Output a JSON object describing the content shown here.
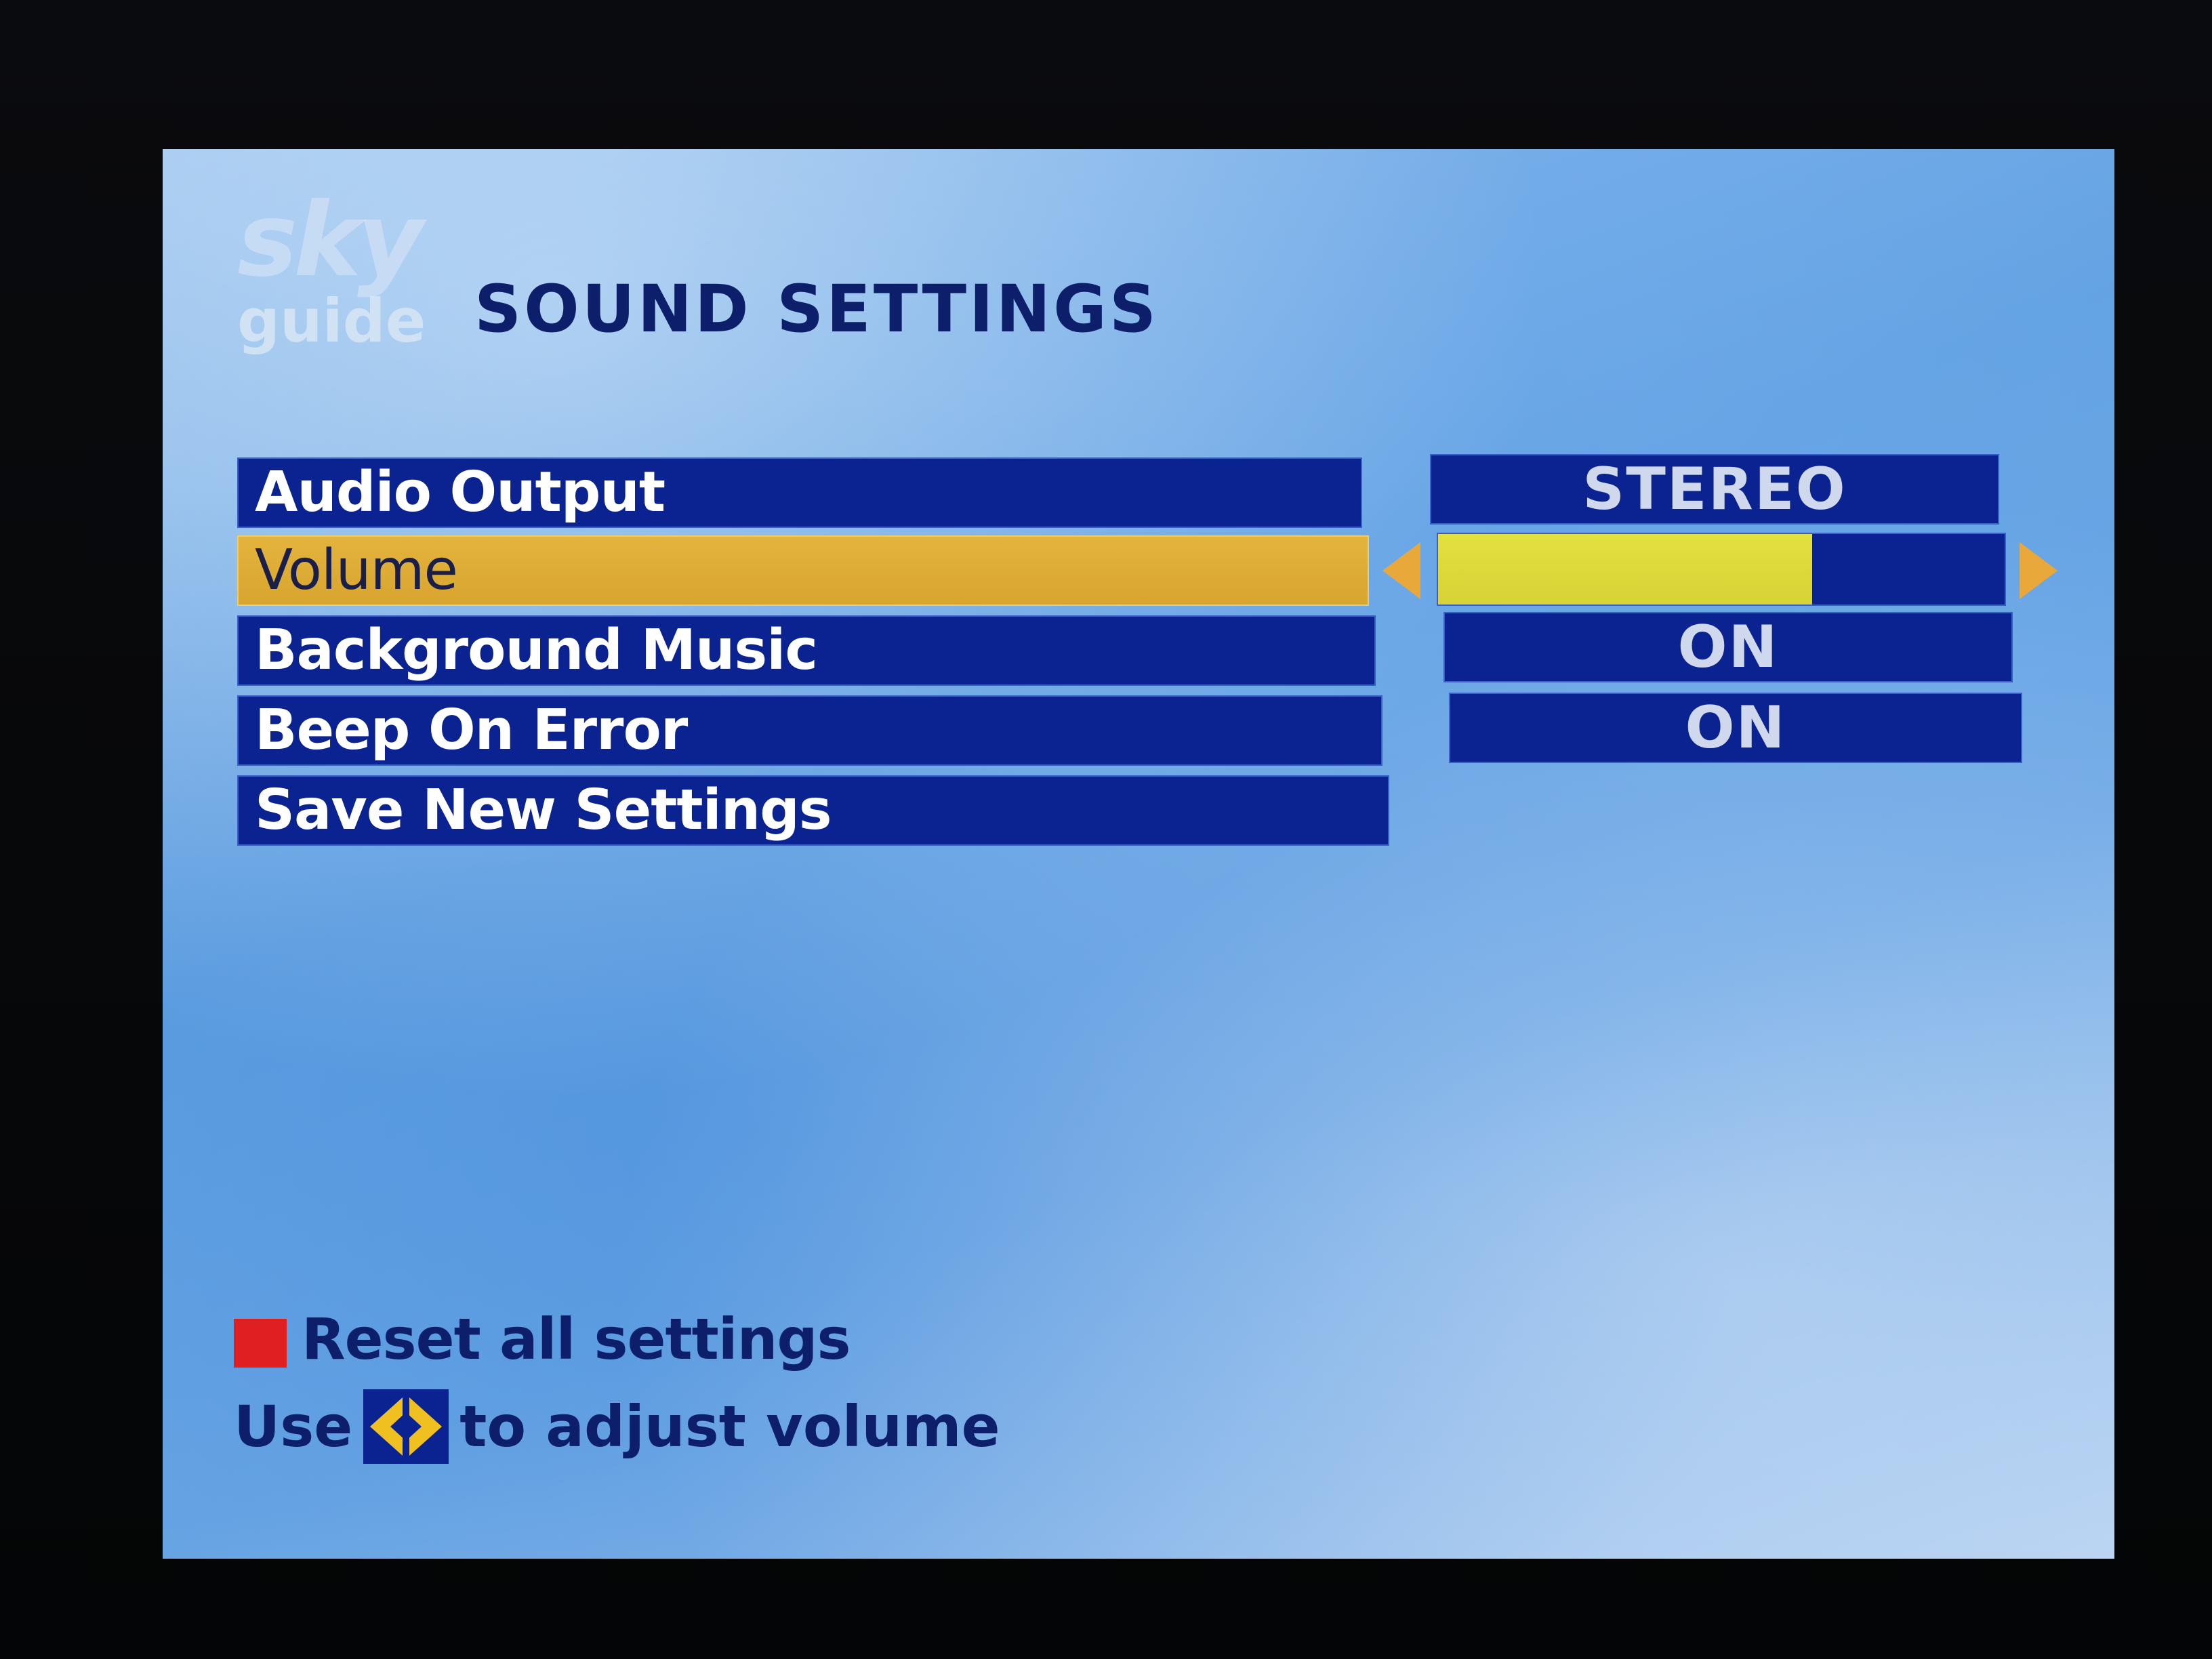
{
  "header": {
    "logo_brand": "sky",
    "logo_sub": "guide",
    "title": "SOUND SETTINGS"
  },
  "menu": {
    "items": [
      {
        "label": "Audio Output",
        "value": "STEREO",
        "selected": false
      },
      {
        "label": "Volume",
        "value_fraction": 0.66,
        "selected": true
      },
      {
        "label": "Background Music",
        "value": "ON",
        "selected": false
      },
      {
        "label": "Beep On Error",
        "value": "ON",
        "selected": false
      },
      {
        "label": "Save New Settings",
        "selected": false
      }
    ]
  },
  "footer": {
    "reset_label": "Reset all settings",
    "hint_prefix": "Use",
    "hint_suffix": "to adjust volume",
    "hint_icon": "left-right-arrows-icon",
    "reset_key_icon": "red-button-icon"
  },
  "colors": {
    "background": "#6aa6e4",
    "row": "#0b2391",
    "selected_row": "#d8a52e",
    "volume_fill": "#dcd83a",
    "arrow": "#e9a93a",
    "title_text": "#0d1f6b",
    "red_key": "#e02020"
  }
}
